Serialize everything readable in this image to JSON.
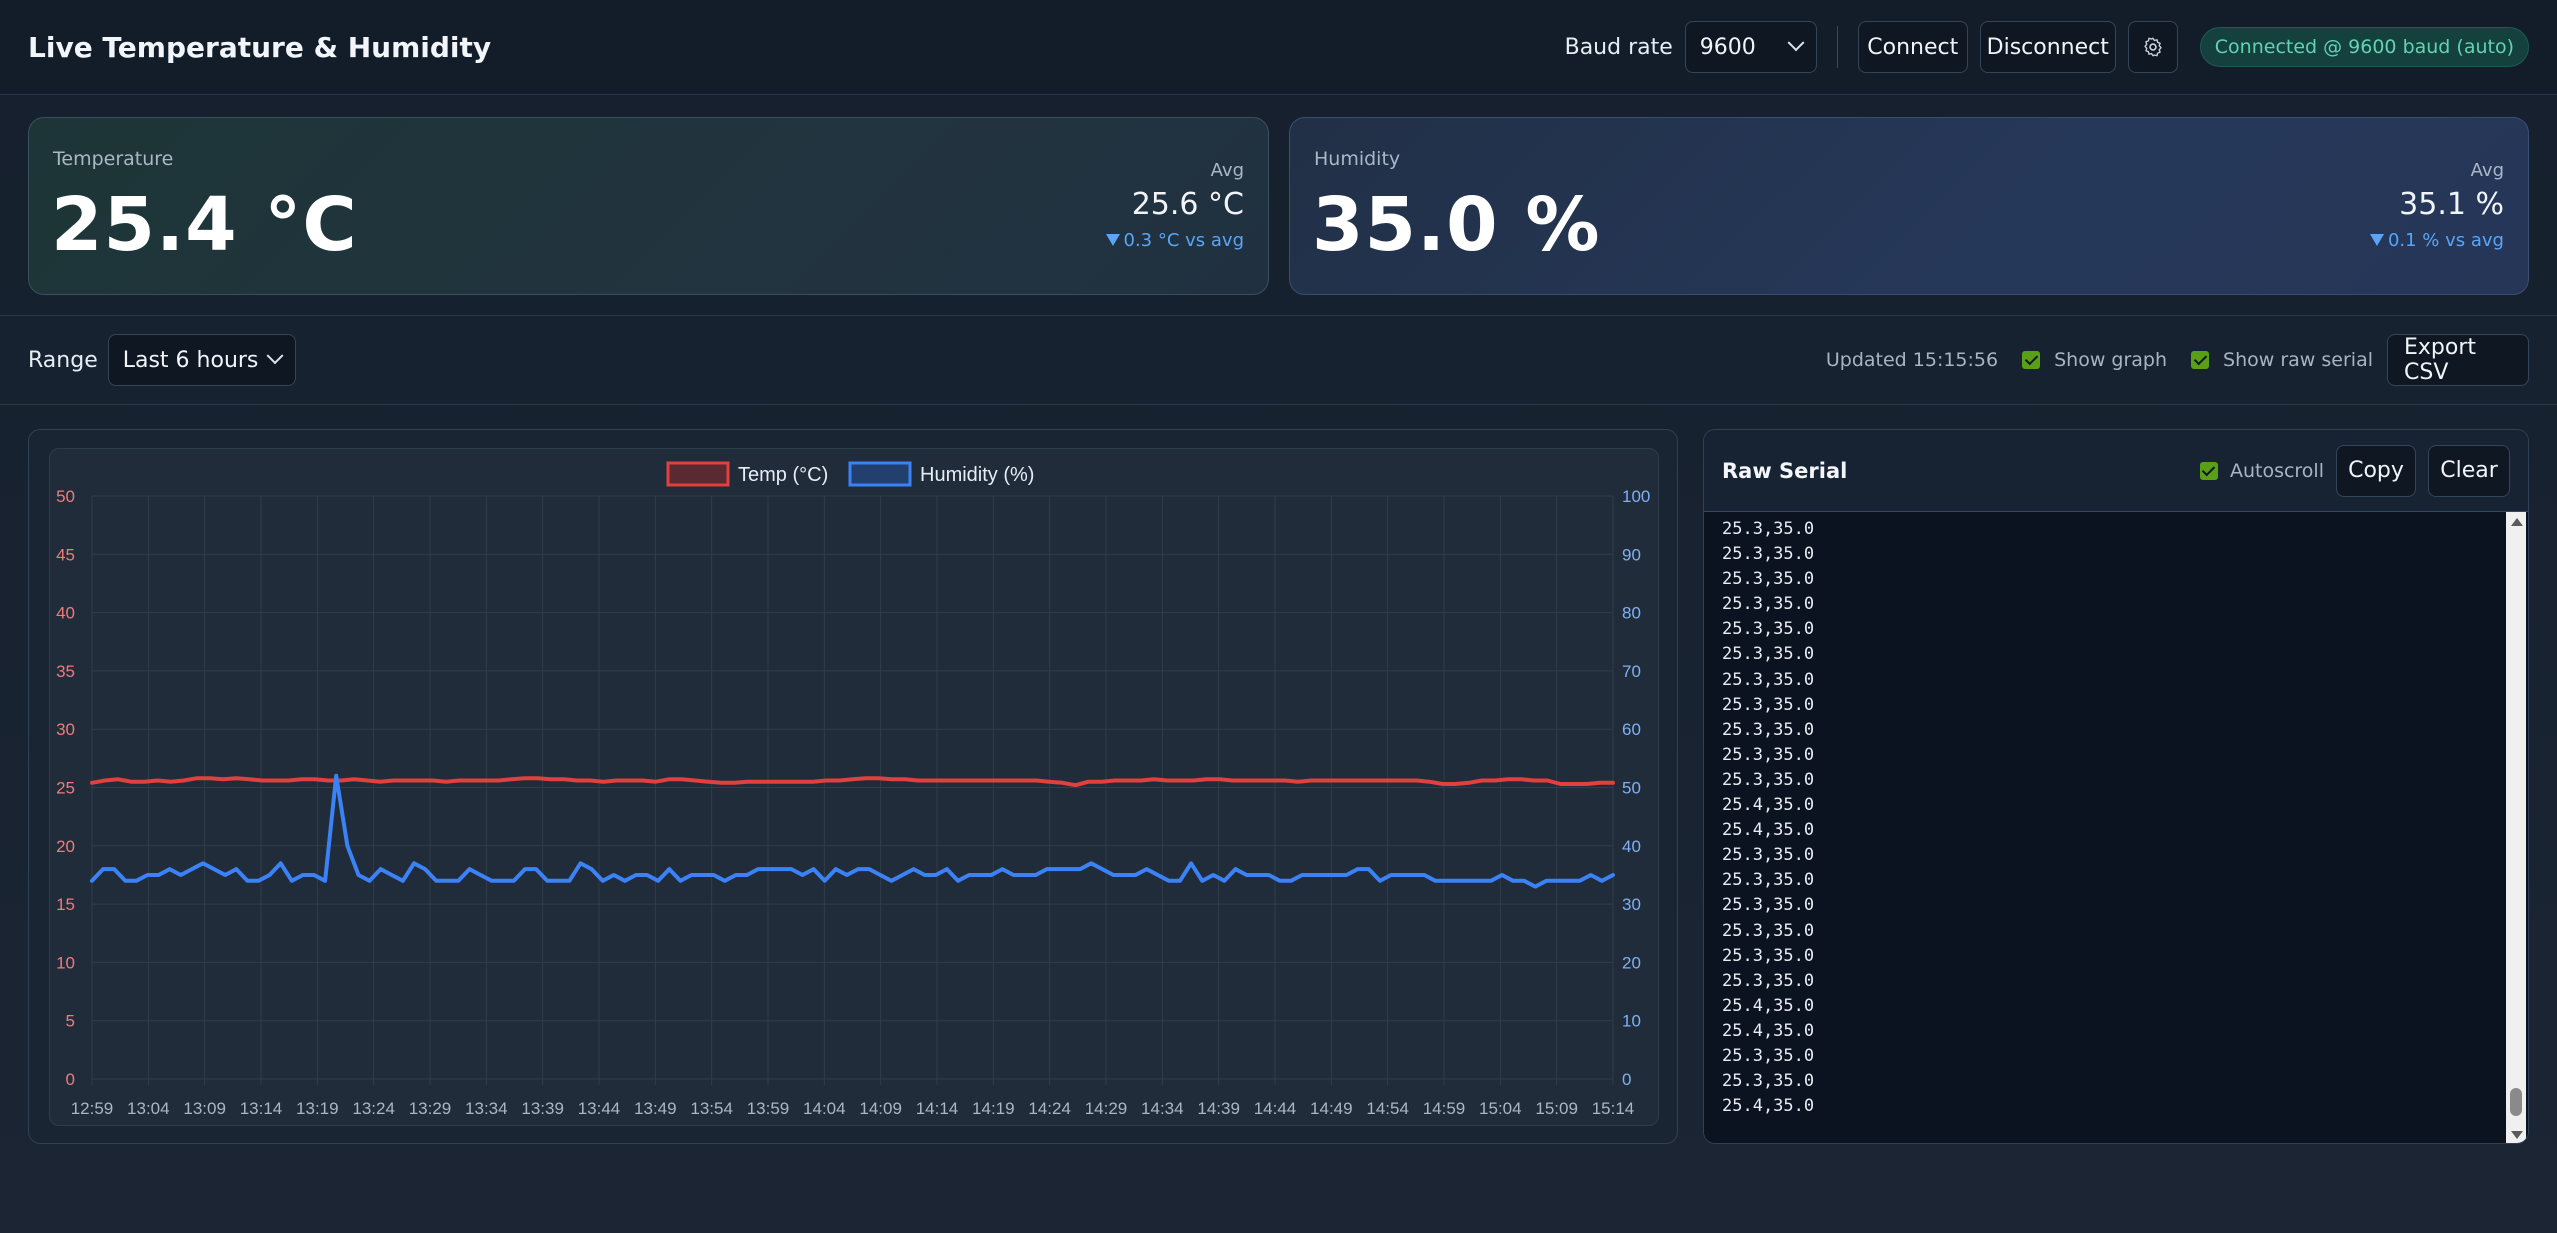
{
  "header": {
    "title": "Live Temperature & Humidity",
    "baud_label": "Baud rate",
    "baud_value": "9600",
    "connect_label": "Connect",
    "disconnect_label": "Disconnect",
    "settings_icon": "gear-icon",
    "status": "Connected @ 9600 baud (auto)"
  },
  "temperature": {
    "label": "Temperature",
    "value": "25.4 °C",
    "avg_label": "Avg",
    "avg_value": "25.6 °C",
    "delta": "0.3 °C vs avg"
  },
  "humidity": {
    "label": "Humidity",
    "value": "35.0 %",
    "avg_label": "Avg",
    "avg_value": "35.1 %",
    "delta": "0.1 % vs avg"
  },
  "toolbar": {
    "range_label": "Range",
    "range_value": "Last 6 hours",
    "updated": "Updated 15:15:56",
    "show_graph_label": "Show graph",
    "show_raw_label": "Show raw serial",
    "export_label": "Export CSV"
  },
  "colors": {
    "temp": "#e0403e",
    "humidity": "#3b82f6",
    "accent_green": "#5aa016"
  },
  "chart_data": {
    "type": "line",
    "title": "",
    "legend_position": "top-center",
    "x": [
      "12:59",
      "13:04",
      "13:09",
      "13:14",
      "13:19",
      "13:24",
      "13:29",
      "13:34",
      "13:39",
      "13:44",
      "13:49",
      "13:54",
      "13:59",
      "14:04",
      "14:09",
      "14:14",
      "14:19",
      "14:24",
      "14:29",
      "14:34",
      "14:39",
      "14:44",
      "14:49",
      "14:54",
      "14:59",
      "15:04",
      "15:09",
      "15:14"
    ],
    "y_left": {
      "min": 0,
      "max": 50,
      "ticks": [
        0,
        5,
        10,
        15,
        20,
        25,
        30,
        35,
        40,
        45,
        50
      ]
    },
    "y_right": {
      "min": 0,
      "max": 100,
      "ticks": [
        0,
        10,
        20,
        30,
        40,
        50,
        60,
        70,
        80,
        90,
        100
      ]
    },
    "grid": true,
    "series": [
      {
        "name": "Temp (°C)",
        "axis": "left",
        "color": "#e0403e",
        "values": [
          25.4,
          25.6,
          25.7,
          25.5,
          25.5,
          25.6,
          25.5,
          25.6,
          25.8,
          25.8,
          25.7,
          25.8,
          25.7,
          25.6,
          25.6,
          25.6,
          25.7,
          25.7,
          25.6,
          25.6,
          25.7,
          25.6,
          25.5,
          25.6,
          25.6,
          25.6,
          25.6,
          25.5,
          25.6,
          25.6,
          25.6,
          25.6,
          25.7,
          25.8,
          25.8,
          25.7,
          25.7,
          25.6,
          25.6,
          25.5,
          25.6,
          25.6,
          25.6,
          25.5,
          25.7,
          25.7,
          25.6,
          25.5,
          25.4,
          25.4,
          25.5,
          25.5,
          25.5,
          25.5,
          25.5,
          25.5,
          25.6,
          25.6,
          25.7,
          25.8,
          25.8,
          25.7,
          25.7,
          25.6,
          25.6,
          25.6,
          25.6,
          25.6,
          25.6,
          25.6,
          25.6,
          25.6,
          25.6,
          25.5,
          25.4,
          25.2,
          25.5,
          25.5,
          25.6,
          25.6,
          25.6,
          25.7,
          25.6,
          25.6,
          25.6,
          25.7,
          25.7,
          25.6,
          25.6,
          25.6,
          25.6,
          25.6,
          25.5,
          25.6,
          25.6,
          25.6,
          25.6,
          25.6,
          25.6,
          25.6,
          25.6,
          25.6,
          25.5,
          25.3,
          25.3,
          25.4,
          25.6,
          25.6,
          25.7,
          25.7,
          25.6,
          25.6,
          25.3,
          25.3,
          25.3,
          25.4,
          25.4
        ]
      },
      {
        "name": "Humidity (%)",
        "axis": "right",
        "color": "#3b82f6",
        "values": [
          34,
          36,
          36,
          34,
          34,
          35,
          35,
          36,
          35,
          36,
          37,
          36,
          35,
          36,
          34,
          34,
          35,
          37,
          34,
          35,
          35,
          34,
          52,
          40,
          35,
          34,
          36,
          35,
          34,
          37,
          36,
          34,
          34,
          34,
          36,
          35,
          34,
          34,
          34,
          36,
          36,
          34,
          34,
          34,
          37,
          36,
          34,
          35,
          34,
          35,
          35,
          34,
          36,
          34,
          35,
          35,
          35,
          34,
          35,
          35,
          36,
          36,
          36,
          36,
          35,
          36,
          34,
          36,
          35,
          36,
          36,
          35,
          34,
          35,
          36,
          35,
          35,
          36,
          34,
          35,
          35,
          35,
          36,
          35,
          35,
          35,
          36,
          36,
          36,
          36,
          37,
          36,
          35,
          35,
          35,
          36,
          35,
          34,
          34,
          37,
          34,
          35,
          34,
          36,
          35,
          35,
          35,
          34,
          34,
          35,
          35,
          35,
          35,
          35,
          36,
          36,
          34,
          35,
          35,
          35,
          35,
          34,
          34,
          34,
          34,
          34,
          34,
          35,
          34,
          34,
          33,
          34,
          34,
          34,
          34,
          35,
          34,
          35
        ]
      }
    ]
  },
  "serial": {
    "title": "Raw Serial",
    "autoscroll_label": "Autoscroll",
    "copy_label": "Copy",
    "clear_label": "Clear",
    "lines": [
      "25.3,35.0",
      "25.3,35.0",
      "25.3,35.0",
      "25.3,35.0",
      "25.3,35.0",
      "25.3,35.0",
      "25.3,35.0",
      "25.3,35.0",
      "25.3,35.0",
      "25.3,35.0",
      "25.3,35.0",
      "25.4,35.0",
      "25.4,35.0",
      "25.3,35.0",
      "25.3,35.0",
      "25.3,35.0",
      "25.3,35.0",
      "25.3,35.0",
      "25.3,35.0",
      "25.4,35.0",
      "25.4,35.0",
      "25.3,35.0",
      "25.3,35.0",
      "25.4,35.0"
    ]
  }
}
